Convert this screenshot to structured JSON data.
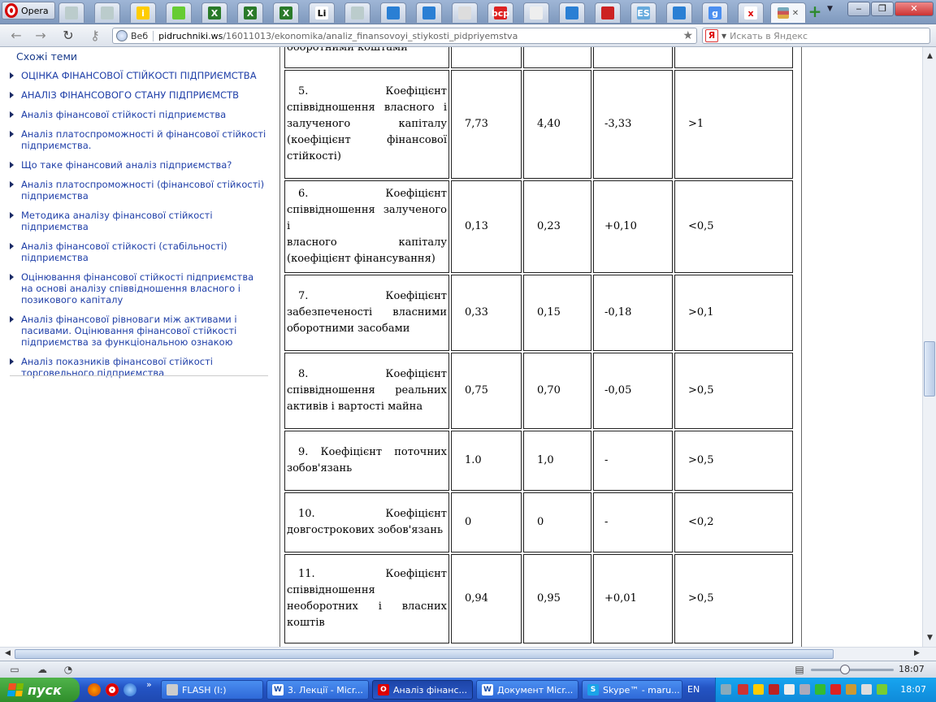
{
  "browser": {
    "app_name": "Opera",
    "active_tab_close": "✕",
    "address": {
      "security_label": "Веб",
      "domain": "pidruchniki.ws",
      "path": "/16011013/ekonomika/analiz_finansovoyi_stiykosti_pidpriyemstva"
    },
    "search": {
      "placeholder": "Искать в Яндекс",
      "engine_badge": "Я"
    },
    "tabs": [
      {
        "icon": "page-icon",
        "label": ""
      },
      {
        "icon": "page-icon",
        "label": ""
      },
      {
        "icon": "info-icon",
        "label": "i"
      },
      {
        "icon": "apple-icon",
        "label": ""
      },
      {
        "icon": "excel-icon",
        "label": "X"
      },
      {
        "icon": "excel-icon",
        "label": "X"
      },
      {
        "icon": "excel-icon",
        "label": "X"
      },
      {
        "icon": "li-icon",
        "label": "Li"
      },
      {
        "icon": "page-icon",
        "label": ""
      },
      {
        "icon": "upload-arrow-icon",
        "label": ""
      },
      {
        "icon": "upload-arrow-icon",
        "label": ""
      },
      {
        "icon": "document-icon",
        "label": ""
      },
      {
        "icon": "site-logo-icon",
        "label": "bcp"
      },
      {
        "icon": "chart-icon",
        "label": ""
      },
      {
        "icon": "upload-arrow-icon",
        "label": ""
      },
      {
        "icon": "wave-icon",
        "label": ""
      },
      {
        "icon": "es-icon",
        "label": "ES"
      },
      {
        "icon": "upload-arrow-icon",
        "label": ""
      },
      {
        "icon": "google-icon",
        "label": "g"
      },
      {
        "icon": "x-logo-icon",
        "label": "x"
      }
    ]
  },
  "sidebar": {
    "title": "Схожі теми",
    "items": [
      "ОЦІНКА ФІНАНСОВОЇ СТІЙКОСТІ ПІДПРИЄМСТВА",
      "АНАЛІЗ ФІНАНСОВОГО СТАНУ ПІДПРИЄМСТВ",
      "Аналіз фінансової стійкості підприємства",
      "Аналіз платоспроможності й фінансової стійкості підприємства.",
      "Що таке фінансовий аналіз підприємства?",
      "Аналіз платоспроможності (фінансової стійкості) підприємства",
      "Методика аналізу фінансової стійкості підприємства",
      "Аналіз фінансової стійкості (стабільності) підприємства",
      "Оцінювання фінансової стійкості підприємства на основі аналізу співвідношення власного і позикового капіталу",
      "Аналіз фінансової рівноваги між активами і пасивами. Оцінювання фінансової стійкості підприємства за функціональною ознакою",
      "Аналіз показників фінансової стійкості торговельного підприємства"
    ]
  },
  "table": {
    "rows": [
      {
        "name": [
          "оборотними коштами"
        ],
        "v1": "",
        "v2": "",
        "diff": "",
        "norm": ""
      },
      {
        "name": [
          "5. Коефіцієнт",
          "співвідношення власного і",
          "залученого капіталу",
          "(коефіцієнт фінансової",
          "стійкості)"
        ],
        "v1": "7,73",
        "v2": "4,40",
        "diff": "-3,33",
        "norm": ">1"
      },
      {
        "name": [
          "6. Коефіцієнт",
          "співвідношення залученого і",
          "власного капіталу",
          "(коефіцієнт фінансування)"
        ],
        "v1": "0,13",
        "v2": "0,23",
        "diff": "+0,10",
        "norm": "<0,5"
      },
      {
        "name": [
          "7. Коефіцієнт",
          "забезпеченості власними",
          "оборотними засобами"
        ],
        "v1": "0,33",
        "v2": "0,15",
        "diff": "-0,18",
        "norm": ">0,1"
      },
      {
        "name": [
          "8. Коефіцієнт",
          "співвідношення реальних",
          "активів і вартості майна"
        ],
        "v1": "0,75",
        "v2": "0,70",
        "diff": "-0,05",
        "norm": ">0,5"
      },
      {
        "name": [
          "9. Коефіцієнт поточних",
          "зобов'язань"
        ],
        "v1": "1.0",
        "v2": "1,0",
        "diff": "-",
        "norm": ">0,5"
      },
      {
        "name": [
          "10. Коефіцієнт",
          "довгострокових зобов'язань"
        ],
        "v1": "0",
        "v2": "0",
        "diff": "-",
        "norm": "<0,2"
      },
      {
        "name": [
          "11. Коефіцієнт",
          "співвідношення",
          "необоротних і власних",
          "коштів"
        ],
        "v1": "0,94",
        "v2": "0,95",
        "diff": "+0,01",
        "norm": ">0,5"
      }
    ]
  },
  "statusbar": {
    "zoom": "18:07"
  },
  "taskbar": {
    "start_label": "пуск",
    "quick_more": "»",
    "tasks": [
      {
        "icon": "drive-icon",
        "label": "FLASH (I:)"
      },
      {
        "icon": "word-icon",
        "label": "3. Лекції - Micr..."
      },
      {
        "icon": "opera-icon",
        "label": "Аналіз фінанс..."
      },
      {
        "icon": "word-icon",
        "label": "Документ Micr..."
      },
      {
        "icon": "skype-icon",
        "label": "Skype™ - maru..."
      }
    ],
    "language": "EN",
    "clock": "18:07"
  },
  "colors": {
    "link": "#1f3fa8",
    "sidebar_title": "#1a3c8c",
    "taskbar": "#2454c4",
    "tray": "#0f8ad9"
  }
}
